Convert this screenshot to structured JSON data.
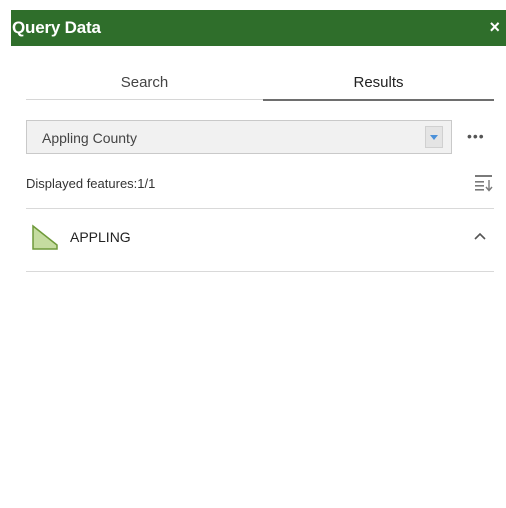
{
  "panel": {
    "title": "Query Data",
    "close_label": "×"
  },
  "tabs": {
    "search_label": "Search",
    "results_label": "Results",
    "active": "Results"
  },
  "layer_select": {
    "value": "Appling County"
  },
  "more_options": {
    "label": "•••"
  },
  "features": {
    "count_text": "Displayed features:1/1",
    "items": [
      {
        "label": "APPLING",
        "icon": "polygon-symbol-icon",
        "expanded": true
      }
    ]
  },
  "colors": {
    "header_bg": "#2f6e2b",
    "polygon_fill": "#c5dca0",
    "polygon_stroke": "#6f9a3a"
  }
}
